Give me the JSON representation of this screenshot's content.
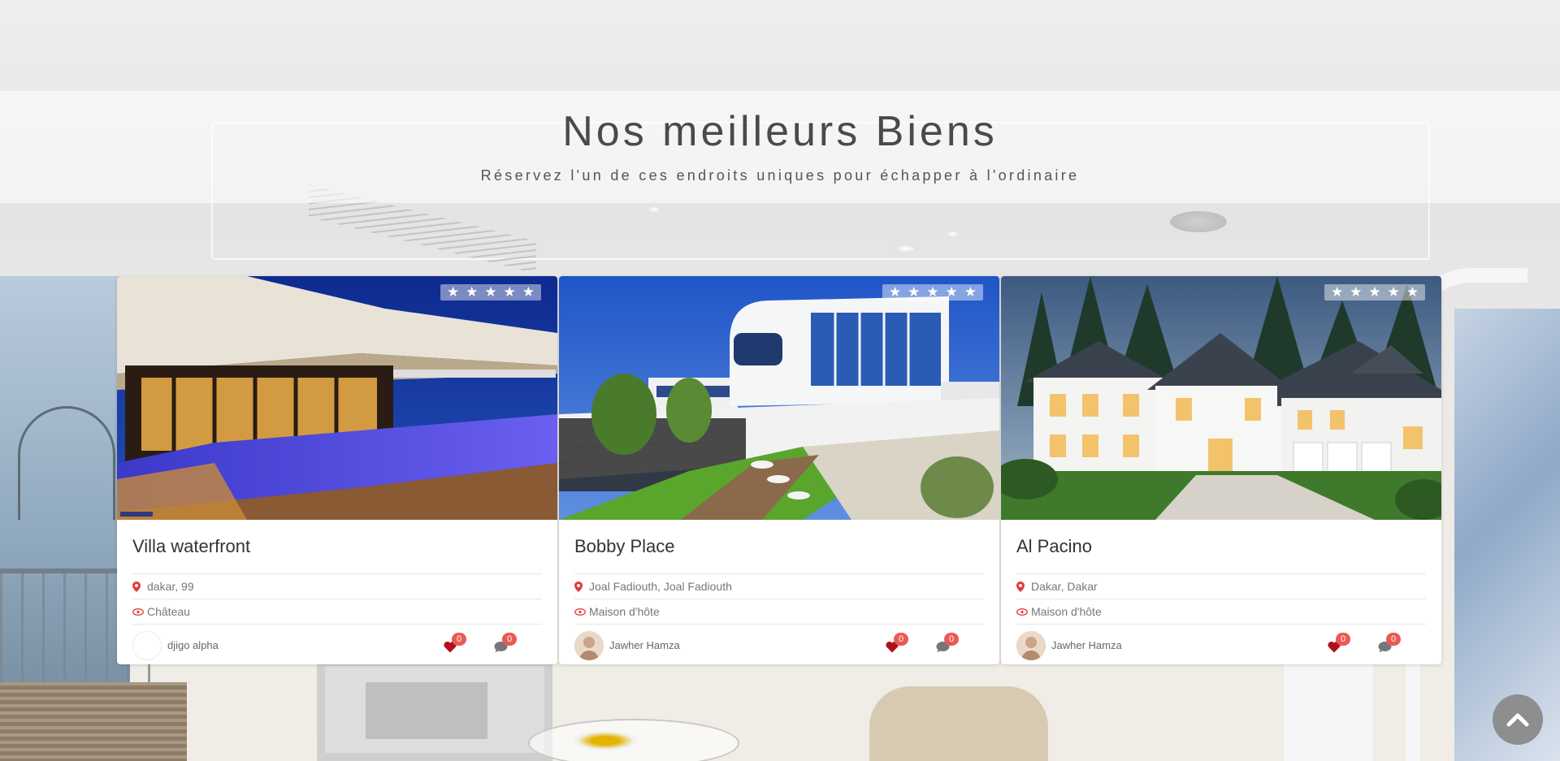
{
  "header": {
    "title": "Nos meilleurs Biens",
    "subtitle": "Réservez l'un de ces endroits uniques pour échapper à l'ordinaire"
  },
  "colors": {
    "accent": "#ea5a55",
    "heart": "#b0101a",
    "comment": "#777777",
    "pin": "#e23b3b"
  },
  "cards": [
    {
      "title": "Villa waterfront",
      "location": "dakar, 99",
      "type": "Château",
      "author": "djigo alpha",
      "likes": "0",
      "comments": "0",
      "rating": 5,
      "image": "modern-villa-infinity-pool-night"
    },
    {
      "title": "Bobby Place",
      "location": "Joal Fadiouth, Joal Fadiouth",
      "type": "Maison d'hôte",
      "author": "Jawher Hamza",
      "likes": "0",
      "comments": "0",
      "rating": 5,
      "image": "white-modern-house-garden"
    },
    {
      "title": "Al Pacino",
      "location": "Dakar, Dakar",
      "type": "Maison d'hôte",
      "author": "Jawher Hamza",
      "likes": "0",
      "comments": "0",
      "rating": 5,
      "image": "white-colonial-house-dusk"
    }
  ],
  "scroll_top": {
    "icon": "chevron-up-icon"
  }
}
